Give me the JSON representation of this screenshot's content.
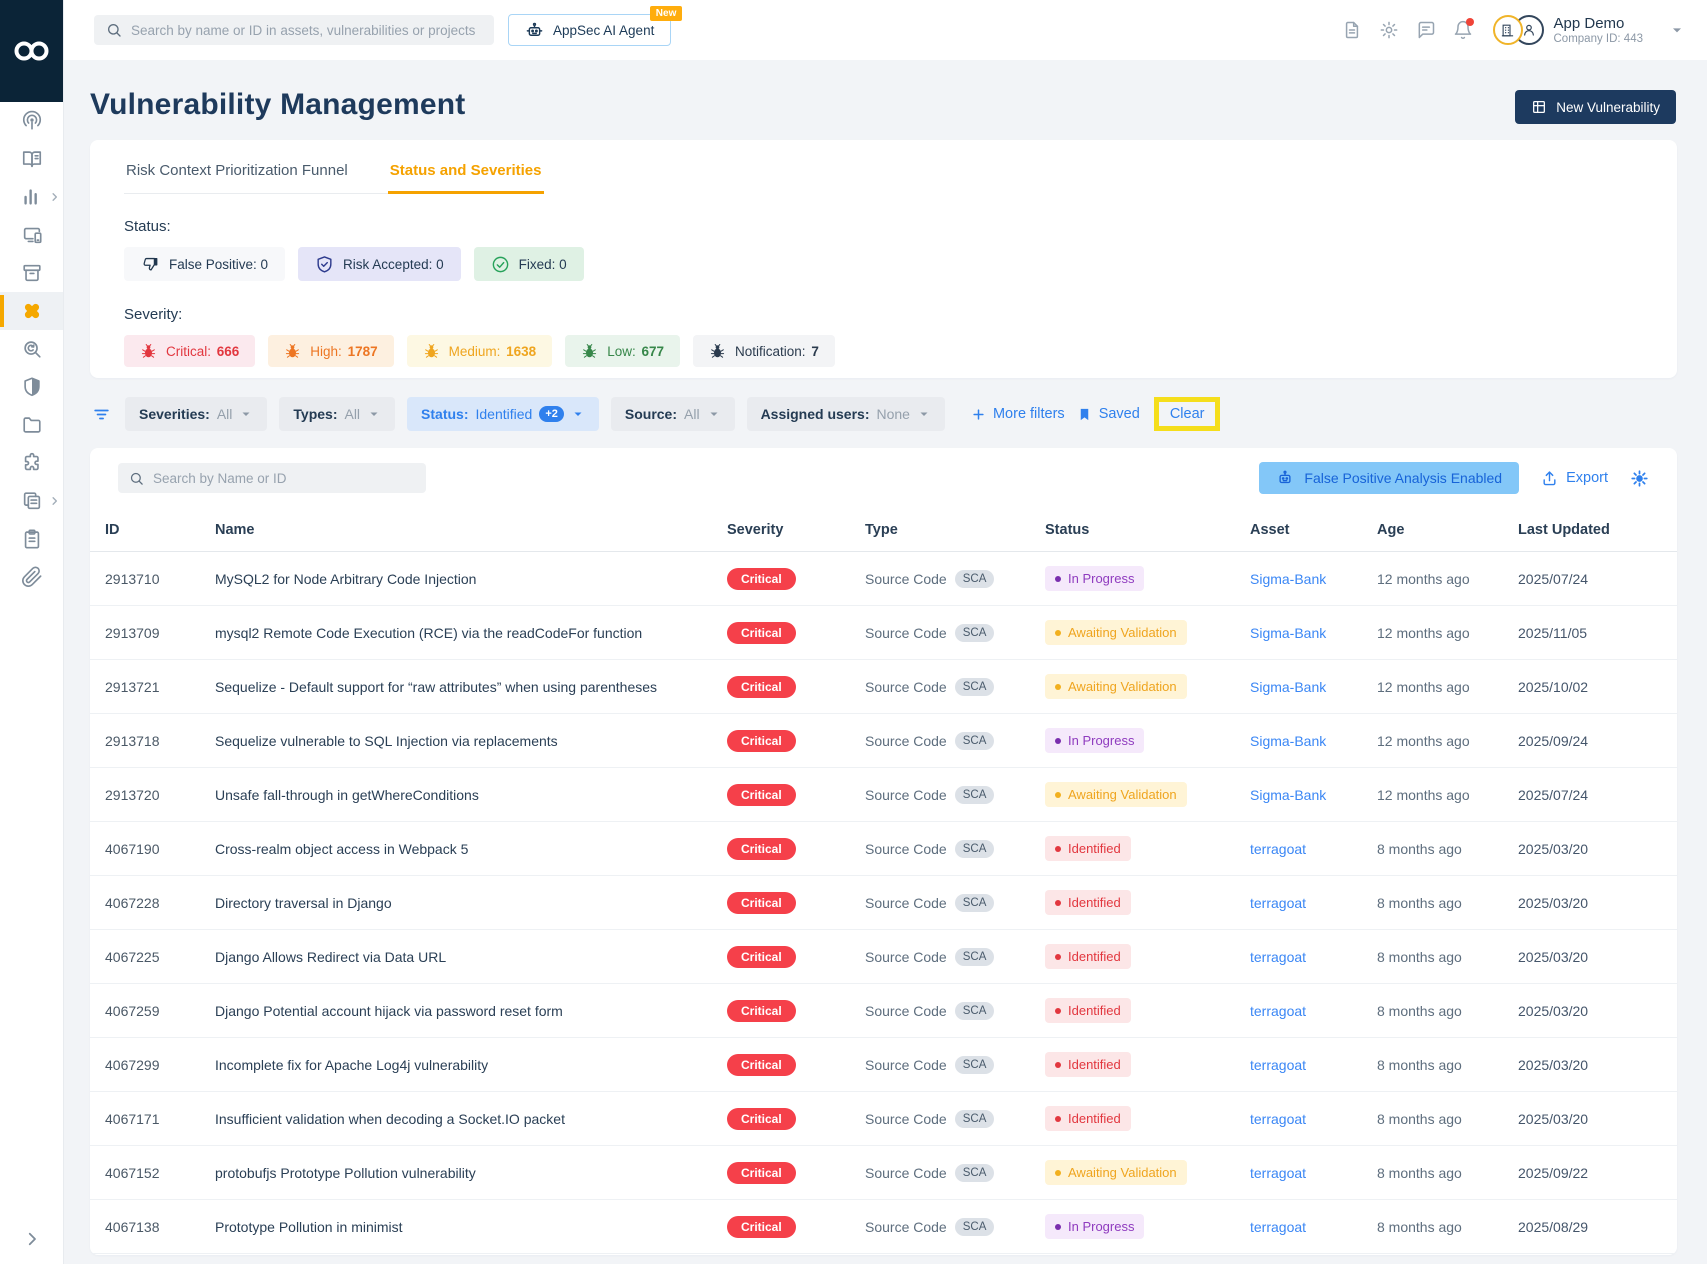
{
  "topbar": {
    "search_placeholder": "Search by name or ID in assets, vulnerabilities or projects",
    "ai_button": {
      "label": "AppSec AI Agent",
      "badge": "New",
      "icon": "robot-icon"
    },
    "actions": [
      {
        "name": "documents-button",
        "icon": "document-icon"
      },
      {
        "name": "settings-button",
        "icon": "gear-icon"
      },
      {
        "name": "feedback-button",
        "icon": "chat-icon"
      },
      {
        "name": "notifications-button",
        "icon": "bell-icon",
        "dot": true
      }
    ],
    "user": {
      "name": "App Demo",
      "company": "Company ID: 443"
    }
  },
  "sidebar": {
    "items": [
      {
        "icon": "radar-icon"
      },
      {
        "icon": "book-icon"
      },
      {
        "icon": "bar-chart-icon",
        "chevron": true
      },
      {
        "icon": "devices-icon"
      },
      {
        "icon": "archive-icon"
      },
      {
        "icon": "bandaid-icon",
        "active": true
      },
      {
        "icon": "scan-search-icon"
      },
      {
        "icon": "shield-icon"
      },
      {
        "icon": "folder-icon"
      },
      {
        "icon": "puzzle-icon"
      },
      {
        "icon": "pages-icon",
        "chevron": true
      },
      {
        "icon": "clipboard-icon"
      },
      {
        "icon": "paperclip-icon"
      }
    ]
  },
  "page": {
    "title": "Vulnerability Management",
    "new_button_label": "New Vulnerability",
    "tabs": [
      {
        "label": "Risk Context Prioritization Funnel",
        "active": false
      },
      {
        "label": "Status and Severities",
        "active": true
      }
    ],
    "status_label": "Status:",
    "status_items": [
      {
        "label": "False Positive",
        "count": "0",
        "icon": "thumbs-down-icon",
        "theme": "fp"
      },
      {
        "label": "Risk Accepted",
        "count": "0",
        "icon": "shield-check-icon",
        "theme": "risk"
      },
      {
        "label": "Fixed",
        "count": "0",
        "icon": "check-circle-icon",
        "theme": "fixed"
      }
    ],
    "severity_label": "Severity:",
    "severity_items": [
      {
        "label": "Critical",
        "count": "666",
        "icon": "bug-icon",
        "theme": "critical"
      },
      {
        "label": "High",
        "count": "1787",
        "icon": "bug-icon",
        "theme": "high"
      },
      {
        "label": "Medium",
        "count": "1638",
        "icon": "bug-icon",
        "theme": "medium"
      },
      {
        "label": "Low",
        "count": "677",
        "icon": "bug-icon",
        "theme": "low"
      },
      {
        "label": "Notification",
        "count": "7",
        "icon": "bug-icon",
        "theme": "notification"
      }
    ]
  },
  "filters": {
    "chips": [
      {
        "label": "Severities:",
        "value": "All",
        "active": false
      },
      {
        "label": "Types:",
        "value": "All",
        "active": false
      },
      {
        "label": "Status:",
        "value": "Identified",
        "badge": "+2",
        "active": true
      },
      {
        "label": "Source:",
        "value": "All",
        "active": false
      },
      {
        "label": "Assigned users:",
        "value": "None",
        "active": false
      }
    ],
    "more_filters": "More filters",
    "saved": "Saved",
    "clear": "Clear"
  },
  "table": {
    "search_placeholder": "Search by Name or ID",
    "fp_analysis_label": "False Positive Analysis Enabled",
    "export_label": "Export",
    "columns": [
      "ID",
      "Name",
      "Severity",
      "Type",
      "Status",
      "Asset",
      "Age",
      "Last Updated"
    ],
    "rows": [
      {
        "id": "2913710",
        "name": "MySQL2 for Node Arbitrary Code Injection",
        "severity": "Critical",
        "type": "Source Code",
        "type_badge": "SCA",
        "status": "In Progress",
        "asset": "Sigma-Bank",
        "age": "12 months ago",
        "updated": "2025/07/24"
      },
      {
        "id": "2913709",
        "name": "mysql2 Remote Code Execution (RCE) via the readCodeFor function",
        "severity": "Critical",
        "type": "Source Code",
        "type_badge": "SCA",
        "status": "Awaiting Validation",
        "asset": "Sigma-Bank",
        "age": "12 months ago",
        "updated": "2025/11/05"
      },
      {
        "id": "2913721",
        "name": "Sequelize - Default support for “raw attributes” when using parentheses",
        "severity": "Critical",
        "type": "Source Code",
        "type_badge": "SCA",
        "status": "Awaiting Validation",
        "asset": "Sigma-Bank",
        "age": "12 months ago",
        "updated": "2025/10/02"
      },
      {
        "id": "2913718",
        "name": "Sequelize vulnerable to SQL Injection via replacements",
        "severity": "Critical",
        "type": "Source Code",
        "type_badge": "SCA",
        "status": "In Progress",
        "asset": "Sigma-Bank",
        "age": "12 months ago",
        "updated": "2025/09/24"
      },
      {
        "id": "2913720",
        "name": "Unsafe fall-through in getWhereConditions",
        "severity": "Critical",
        "type": "Source Code",
        "type_badge": "SCA",
        "status": "Awaiting Validation",
        "asset": "Sigma-Bank",
        "age": "12 months ago",
        "updated": "2025/07/24"
      },
      {
        "id": "4067190",
        "name": "Cross-realm object access in Webpack 5",
        "severity": "Critical",
        "type": "Source Code",
        "type_badge": "SCA",
        "status": "Identified",
        "asset": "terragoat",
        "age": "8 months ago",
        "updated": "2025/03/20"
      },
      {
        "id": "4067228",
        "name": "Directory traversal in Django",
        "severity": "Critical",
        "type": "Source Code",
        "type_badge": "SCA",
        "status": "Identified",
        "asset": "terragoat",
        "age": "8 months ago",
        "updated": "2025/03/20"
      },
      {
        "id": "4067225",
        "name": "Django Allows Redirect via Data URL",
        "severity": "Critical",
        "type": "Source Code",
        "type_badge": "SCA",
        "status": "Identified",
        "asset": "terragoat",
        "age": "8 months ago",
        "updated": "2025/03/20"
      },
      {
        "id": "4067259",
        "name": "Django Potential account hijack via password reset form",
        "severity": "Critical",
        "type": "Source Code",
        "type_badge": "SCA",
        "status": "Identified",
        "asset": "terragoat",
        "age": "8 months ago",
        "updated": "2025/03/20"
      },
      {
        "id": "4067299",
        "name": "Incomplete fix for Apache Log4j vulnerability",
        "severity": "Critical",
        "type": "Source Code",
        "type_badge": "SCA",
        "status": "Identified",
        "asset": "terragoat",
        "age": "8 months ago",
        "updated": "2025/03/20"
      },
      {
        "id": "4067171",
        "name": "Insufficient validation when decoding a Socket.IO packet",
        "severity": "Critical",
        "type": "Source Code",
        "type_badge": "SCA",
        "status": "Identified",
        "asset": "terragoat",
        "age": "8 months ago",
        "updated": "2025/03/20"
      },
      {
        "id": "4067152",
        "name": "protobufjs Prototype Pollution vulnerability",
        "severity": "Critical",
        "type": "Source Code",
        "type_badge": "SCA",
        "status": "Awaiting Validation",
        "asset": "terragoat",
        "age": "8 months ago",
        "updated": "2025/09/22"
      },
      {
        "id": "4067138",
        "name": "Prototype Pollution in minimist",
        "severity": "Critical",
        "type": "Source Code",
        "type_badge": "SCA",
        "status": "In Progress",
        "asset": "terragoat",
        "age": "8 months ago",
        "updated": "2025/08/29"
      }
    ]
  },
  "colors": {
    "accent_orange": "#F5A200",
    "accent_blue": "#2F80ED",
    "navy": "#1D3A5F",
    "critical_red": "#F5404A",
    "highlight_yellow": "#F5DE1B"
  }
}
